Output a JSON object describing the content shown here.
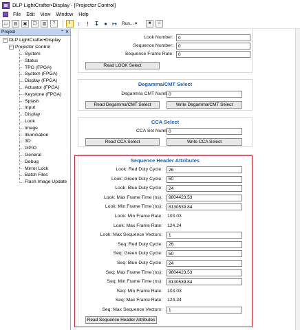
{
  "window": {
    "title": "DLP LightCrafter•Display - [Projector Control]"
  },
  "menu": [
    "File",
    "Edit",
    "View",
    "Window",
    "Help"
  ],
  "toolbar": {
    "run_label": "Run..."
  },
  "project_panel": {
    "title": "Project",
    "root": "DLP LightCrafter•Display",
    "group": "Projector Control",
    "items": [
      "System",
      "Status",
      "TPG (FPGA)",
      "System (FPGA)",
      "Display (FPGA)",
      "Actuator (FPGA)",
      "Keystone (FPGA)",
      "Splash",
      "Input",
      "Display",
      "Look",
      "Image",
      "Illumination",
      "3D",
      "GPIO",
      "General",
      "Debug",
      "Mirror Lock",
      "Batch Files",
      "Flash Image Update"
    ]
  },
  "look_section": {
    "look_number_label": "Look Number:",
    "look_number_value": "0",
    "sequence_number_label": "Sequence Number:",
    "sequence_number_value": "0",
    "sequence_frame_rate_label": "Sequence Frame Rate:",
    "sequence_frame_rate_value": "0",
    "read_button": "Read LOOK Select"
  },
  "degamma_section": {
    "title": "Degamma/CMT Select",
    "label": "Degamma CMT Number:",
    "value": "0",
    "read_button": "Read Degamma/CMT Select",
    "write_button": "Write Degamma/CMT Select"
  },
  "cca_section": {
    "title": "CCA Select",
    "label": "CCA Set Number:",
    "value": "0",
    "read_button": "Read CCA Select",
    "write_button": "Write CCA Select"
  },
  "sequence_header": {
    "title": "Sequence Header Attributes",
    "fields": [
      {
        "label": "Look: Red Duty Cycle:",
        "value": "26",
        "kind": "input"
      },
      {
        "label": "Look: Green Duty Cycle:",
        "value": "50",
        "kind": "input"
      },
      {
        "label": "Look: Blue Duty Cycle:",
        "value": "24",
        "kind": "input"
      },
      {
        "label": "Look: Max Frame Time (ns):",
        "value": "9804423.53",
        "kind": "input"
      },
      {
        "label": "Look: Min Frame Time (ns):",
        "value": "8130539.84",
        "kind": "input"
      },
      {
        "label": "Look: Min Frame Rate:",
        "value": "103.03",
        "kind": "text"
      },
      {
        "label": "Look: Max Frame Rate:",
        "value": "124.24",
        "kind": "text"
      },
      {
        "label": "Look: Max Sequence Vectors:",
        "value": "1",
        "kind": "input"
      },
      {
        "label": "Seq: Red Duty Cycle:",
        "value": "26",
        "kind": "input"
      },
      {
        "label": "Seq: Green Duty Cycle:",
        "value": "50",
        "kind": "input"
      },
      {
        "label": "Seq: Blue Duty Cycle:",
        "value": "24",
        "kind": "input"
      },
      {
        "label": "Seq: Max Frame Time (ns):",
        "value": "9804423.53",
        "kind": "input"
      },
      {
        "label": "Seq: Min Frame Time (ns):",
        "value": "8130539.84",
        "kind": "input"
      },
      {
        "label": "Seq: Min Frame Rate:",
        "value": "103.03",
        "kind": "text"
      },
      {
        "label": "Seq: Max Frame Rate:",
        "value": "124.24",
        "kind": "text"
      },
      {
        "label": "Seq: Max Sequence Vectors:",
        "value": "1",
        "kind": "input"
      }
    ],
    "read_button": "Read Sequence Header Attributes"
  },
  "colors": {
    "section_title": "#1f5fb3",
    "highlight_border": "#c4262e",
    "panel_header": "#bdd3ef"
  }
}
